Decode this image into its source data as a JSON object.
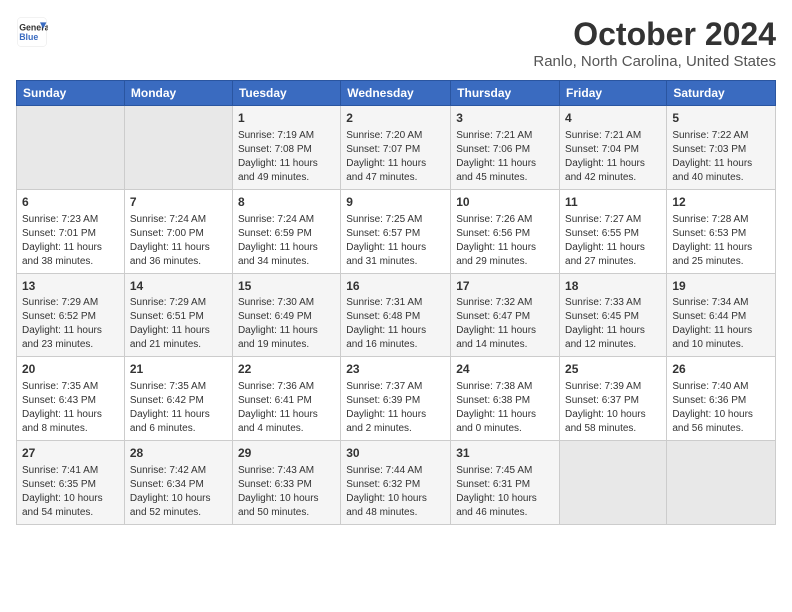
{
  "header": {
    "logo_line1": "General",
    "logo_line2": "Blue",
    "month": "October 2024",
    "location": "Ranlo, North Carolina, United States"
  },
  "days_of_week": [
    "Sunday",
    "Monday",
    "Tuesday",
    "Wednesday",
    "Thursday",
    "Friday",
    "Saturday"
  ],
  "weeks": [
    [
      {
        "day": "",
        "empty": true
      },
      {
        "day": "",
        "empty": true
      },
      {
        "day": "1",
        "sunrise": "7:19 AM",
        "sunset": "7:08 PM",
        "daylight": "11 hours and 49 minutes."
      },
      {
        "day": "2",
        "sunrise": "7:20 AM",
        "sunset": "7:07 PM",
        "daylight": "11 hours and 47 minutes."
      },
      {
        "day": "3",
        "sunrise": "7:21 AM",
        "sunset": "7:06 PM",
        "daylight": "11 hours and 45 minutes."
      },
      {
        "day": "4",
        "sunrise": "7:21 AM",
        "sunset": "7:04 PM",
        "daylight": "11 hours and 42 minutes."
      },
      {
        "day": "5",
        "sunrise": "7:22 AM",
        "sunset": "7:03 PM",
        "daylight": "11 hours and 40 minutes."
      }
    ],
    [
      {
        "day": "6",
        "sunrise": "7:23 AM",
        "sunset": "7:01 PM",
        "daylight": "11 hours and 38 minutes."
      },
      {
        "day": "7",
        "sunrise": "7:24 AM",
        "sunset": "7:00 PM",
        "daylight": "11 hours and 36 minutes."
      },
      {
        "day": "8",
        "sunrise": "7:24 AM",
        "sunset": "6:59 PM",
        "daylight": "11 hours and 34 minutes."
      },
      {
        "day": "9",
        "sunrise": "7:25 AM",
        "sunset": "6:57 PM",
        "daylight": "11 hours and 31 minutes."
      },
      {
        "day": "10",
        "sunrise": "7:26 AM",
        "sunset": "6:56 PM",
        "daylight": "11 hours and 29 minutes."
      },
      {
        "day": "11",
        "sunrise": "7:27 AM",
        "sunset": "6:55 PM",
        "daylight": "11 hours and 27 minutes."
      },
      {
        "day": "12",
        "sunrise": "7:28 AM",
        "sunset": "6:53 PM",
        "daylight": "11 hours and 25 minutes."
      }
    ],
    [
      {
        "day": "13",
        "sunrise": "7:29 AM",
        "sunset": "6:52 PM",
        "daylight": "11 hours and 23 minutes."
      },
      {
        "day": "14",
        "sunrise": "7:29 AM",
        "sunset": "6:51 PM",
        "daylight": "11 hours and 21 minutes."
      },
      {
        "day": "15",
        "sunrise": "7:30 AM",
        "sunset": "6:49 PM",
        "daylight": "11 hours and 19 minutes."
      },
      {
        "day": "16",
        "sunrise": "7:31 AM",
        "sunset": "6:48 PM",
        "daylight": "11 hours and 16 minutes."
      },
      {
        "day": "17",
        "sunrise": "7:32 AM",
        "sunset": "6:47 PM",
        "daylight": "11 hours and 14 minutes."
      },
      {
        "day": "18",
        "sunrise": "7:33 AM",
        "sunset": "6:45 PM",
        "daylight": "11 hours and 12 minutes."
      },
      {
        "day": "19",
        "sunrise": "7:34 AM",
        "sunset": "6:44 PM",
        "daylight": "11 hours and 10 minutes."
      }
    ],
    [
      {
        "day": "20",
        "sunrise": "7:35 AM",
        "sunset": "6:43 PM",
        "daylight": "11 hours and 8 minutes."
      },
      {
        "day": "21",
        "sunrise": "7:35 AM",
        "sunset": "6:42 PM",
        "daylight": "11 hours and 6 minutes."
      },
      {
        "day": "22",
        "sunrise": "7:36 AM",
        "sunset": "6:41 PM",
        "daylight": "11 hours and 4 minutes."
      },
      {
        "day": "23",
        "sunrise": "7:37 AM",
        "sunset": "6:39 PM",
        "daylight": "11 hours and 2 minutes."
      },
      {
        "day": "24",
        "sunrise": "7:38 AM",
        "sunset": "6:38 PM",
        "daylight": "11 hours and 0 minutes."
      },
      {
        "day": "25",
        "sunrise": "7:39 AM",
        "sunset": "6:37 PM",
        "daylight": "10 hours and 58 minutes."
      },
      {
        "day": "26",
        "sunrise": "7:40 AM",
        "sunset": "6:36 PM",
        "daylight": "10 hours and 56 minutes."
      }
    ],
    [
      {
        "day": "27",
        "sunrise": "7:41 AM",
        "sunset": "6:35 PM",
        "daylight": "10 hours and 54 minutes."
      },
      {
        "day": "28",
        "sunrise": "7:42 AM",
        "sunset": "6:34 PM",
        "daylight": "10 hours and 52 minutes."
      },
      {
        "day": "29",
        "sunrise": "7:43 AM",
        "sunset": "6:33 PM",
        "daylight": "10 hours and 50 minutes."
      },
      {
        "day": "30",
        "sunrise": "7:44 AM",
        "sunset": "6:32 PM",
        "daylight": "10 hours and 48 minutes."
      },
      {
        "day": "31",
        "sunrise": "7:45 AM",
        "sunset": "6:31 PM",
        "daylight": "10 hours and 46 minutes."
      },
      {
        "day": "",
        "empty": true
      },
      {
        "day": "",
        "empty": true
      }
    ]
  ]
}
